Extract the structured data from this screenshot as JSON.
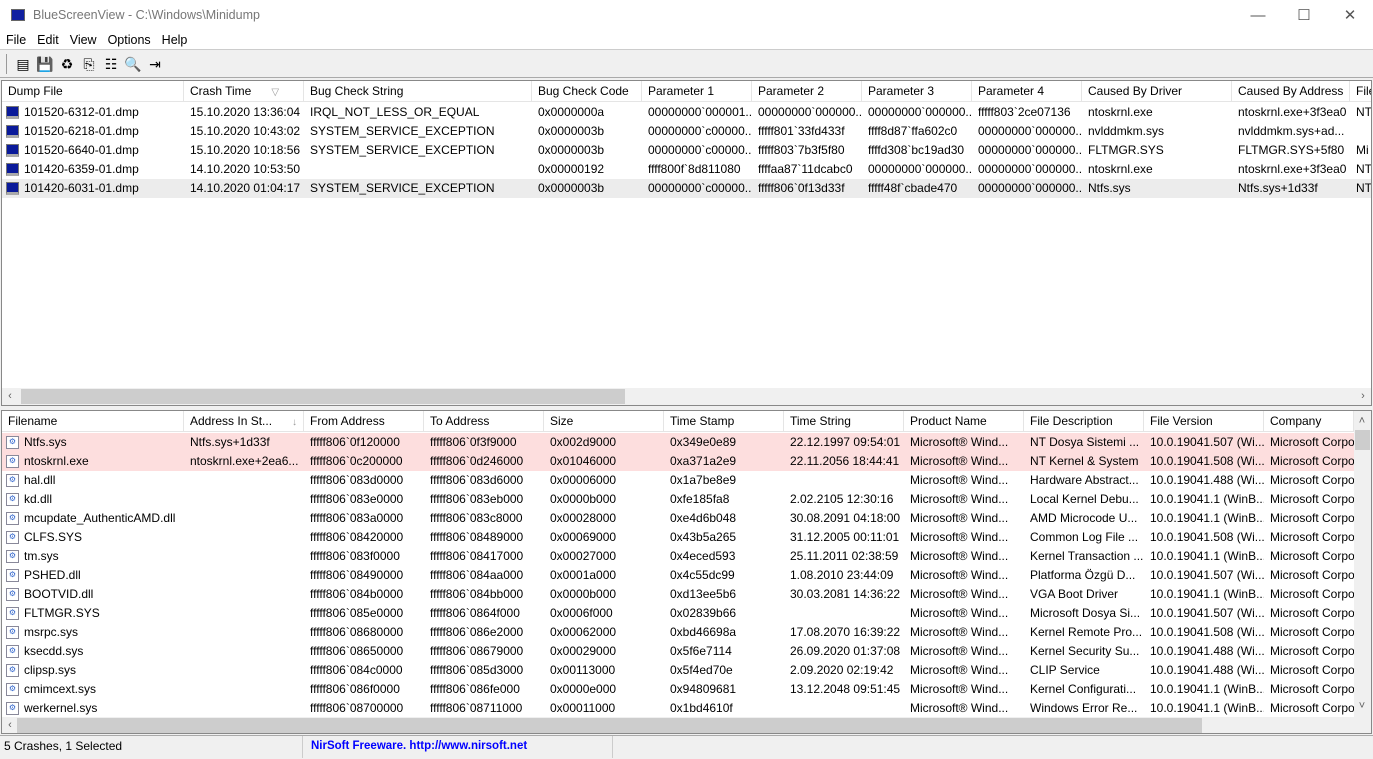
{
  "window": {
    "title": "BlueScreenView  -  C:\\Windows\\Minidump",
    "minimize": "—",
    "maximize": "☐",
    "close": "✕"
  },
  "menu": [
    "File",
    "Edit",
    "View",
    "Options",
    "Help"
  ],
  "toolbar": [
    {
      "icon": "html-report-icon",
      "glyph": "▤"
    },
    {
      "icon": "save-icon",
      "glyph": "💾"
    },
    {
      "icon": "refresh-icon",
      "glyph": "♻"
    },
    {
      "icon": "copy-icon",
      "glyph": "⎘"
    },
    {
      "icon": "properties-icon",
      "glyph": "☷"
    },
    {
      "icon": "find-icon",
      "glyph": "🔍"
    },
    {
      "icon": "exit-icon",
      "glyph": "⇥"
    }
  ],
  "crashes": {
    "columns": [
      "Dump File",
      "Crash Time",
      "Bug Check String",
      "Bug Check Code",
      "Parameter 1",
      "Parameter 2",
      "Parameter 3",
      "Parameter 4",
      "Caused By Driver",
      "Caused By Address",
      "File"
    ],
    "sort_indicator": "▽",
    "rows": [
      [
        "101520-6312-01.dmp",
        "15.10.2020 13:36:04",
        "IRQL_NOT_LESS_OR_EQUAL",
        "0x0000000a",
        "00000000`000001...",
        "00000000`000000...",
        "00000000`000000...",
        "fffff803`2ce07136",
        "ntoskrnl.exe",
        "ntoskrnl.exe+3f3ea0",
        "NT"
      ],
      [
        "101520-6218-01.dmp",
        "15.10.2020 10:43:02",
        "SYSTEM_SERVICE_EXCEPTION",
        "0x0000003b",
        "00000000`c00000...",
        "fffff801`33fd433f",
        "ffff8d87`ffa602c0",
        "00000000`000000...",
        "nvlddmkm.sys",
        "nvlddmkm.sys+ad...",
        ""
      ],
      [
        "101520-6640-01.dmp",
        "15.10.2020 10:18:56",
        "SYSTEM_SERVICE_EXCEPTION",
        "0x0000003b",
        "00000000`c00000...",
        "fffff803`7b3f5f80",
        "ffffd308`bc19ad30",
        "00000000`000000...",
        "FLTMGR.SYS",
        "FLTMGR.SYS+5f80",
        "Mi"
      ],
      [
        "101420-6359-01.dmp",
        "14.10.2020 10:53:50",
        "",
        "0x00000192",
        "ffff800f`8d811080",
        "ffffaa87`11dcabc0",
        "00000000`000000...",
        "00000000`000000...",
        "ntoskrnl.exe",
        "ntoskrnl.exe+3f3ea0",
        "NT"
      ],
      [
        "101420-6031-01.dmp",
        "14.10.2020 01:04:17",
        "SYSTEM_SERVICE_EXCEPTION",
        "0x0000003b",
        "00000000`c00000...",
        "fffff806`0f13d33f",
        "fffff48f`cbade470",
        "00000000`000000...",
        "Ntfs.sys",
        "Ntfs.sys+1d33f",
        "NT"
      ]
    ],
    "selected_row": 4
  },
  "drivers": {
    "columns": [
      "Filename",
      "Address In St...",
      "From Address",
      "To Address",
      "Size",
      "Time Stamp",
      "Time String",
      "Product Name",
      "File Description",
      "File Version",
      "Company"
    ],
    "sort_indicator": "↓",
    "highlight_color": "#fddede",
    "highlighted_rows": [
      0,
      1
    ],
    "rows": [
      [
        "Ntfs.sys",
        "Ntfs.sys+1d33f",
        "fffff806`0f120000",
        "fffff806`0f3f9000",
        "0x002d9000",
        "0x349e0e89",
        "22.12.1997 09:54:01",
        "Microsoft® Wind...",
        "NT Dosya Sistemi ...",
        "10.0.19041.507 (Wi...",
        "Microsoft Corpo"
      ],
      [
        "ntoskrnl.exe",
        "ntoskrnl.exe+2ea6...",
        "fffff806`0c200000",
        "fffff806`0d246000",
        "0x01046000",
        "0xa371a2e9",
        "22.11.2056 18:44:41",
        "Microsoft® Wind...",
        "NT Kernel & System",
        "10.0.19041.508 (Wi...",
        "Microsoft Corpo"
      ],
      [
        "hal.dll",
        "",
        "fffff806`083d0000",
        "fffff806`083d6000",
        "0x00006000",
        "0x1a7be8e9",
        "",
        "Microsoft® Wind...",
        "Hardware Abstract...",
        "10.0.19041.488 (Wi...",
        "Microsoft Corpo"
      ],
      [
        "kd.dll",
        "",
        "fffff806`083e0000",
        "fffff806`083eb000",
        "0x0000b000",
        "0xfe185fa8",
        "2.02.2105 12:30:16",
        "Microsoft® Wind...",
        "Local Kernel Debu...",
        "10.0.19041.1 (WinB...",
        "Microsoft Corpo"
      ],
      [
        "mcupdate_AuthenticAMD.dll",
        "",
        "fffff806`083a0000",
        "fffff806`083c8000",
        "0x00028000",
        "0xe4d6b048",
        "30.08.2091 04:18:00",
        "Microsoft® Wind...",
        "AMD Microcode U...",
        "10.0.19041.1 (WinB...",
        "Microsoft Corpo"
      ],
      [
        "CLFS.SYS",
        "",
        "fffff806`08420000",
        "fffff806`08489000",
        "0x00069000",
        "0x43b5a265",
        "31.12.2005 00:11:01",
        "Microsoft® Wind...",
        "Common Log File ...",
        "10.0.19041.508 (Wi...",
        "Microsoft Corpo"
      ],
      [
        "tm.sys",
        "",
        "fffff806`083f0000",
        "fffff806`08417000",
        "0x00027000",
        "0x4eced593",
        "25.11.2011 02:38:59",
        "Microsoft® Wind...",
        "Kernel Transaction ...",
        "10.0.19041.1 (WinB...",
        "Microsoft Corpo"
      ],
      [
        "PSHED.dll",
        "",
        "fffff806`08490000",
        "fffff806`084aa000",
        "0x0001a000",
        "0x4c55dc99",
        "1.08.2010 23:44:09",
        "Microsoft® Wind...",
        "Platforma Özgü D...",
        "10.0.19041.507 (Wi...",
        "Microsoft Corpo"
      ],
      [
        "BOOTVID.dll",
        "",
        "fffff806`084b0000",
        "fffff806`084bb000",
        "0x0000b000",
        "0xd13ee5b6",
        "30.03.2081 14:36:22",
        "Microsoft® Wind...",
        "VGA Boot Driver",
        "10.0.19041.1 (WinB...",
        "Microsoft Corpo"
      ],
      [
        "FLTMGR.SYS",
        "",
        "fffff806`085e0000",
        "fffff806`0864f000",
        "0x0006f000",
        "0x02839b66",
        "",
        "Microsoft® Wind...",
        "Microsoft Dosya Si...",
        "10.0.19041.507 (Wi...",
        "Microsoft Corpo"
      ],
      [
        "msrpc.sys",
        "",
        "fffff806`08680000",
        "fffff806`086e2000",
        "0x00062000",
        "0xbd46698a",
        "17.08.2070 16:39:22",
        "Microsoft® Wind...",
        "Kernel Remote Pro...",
        "10.0.19041.508 (Wi...",
        "Microsoft Corpo"
      ],
      [
        "ksecdd.sys",
        "",
        "fffff806`08650000",
        "fffff806`08679000",
        "0x00029000",
        "0x5f6e7114",
        "26.09.2020 01:37:08",
        "Microsoft® Wind...",
        "Kernel Security Su...",
        "10.0.19041.488 (Wi...",
        "Microsoft Corpo"
      ],
      [
        "clipsp.sys",
        "",
        "fffff806`084c0000",
        "fffff806`085d3000",
        "0x00113000",
        "0x5f4ed70e",
        "2.09.2020 02:19:42",
        "Microsoft® Wind...",
        "CLIP Service",
        "10.0.19041.488 (Wi...",
        "Microsoft Corpo"
      ],
      [
        "cmimcext.sys",
        "",
        "fffff806`086f0000",
        "fffff806`086fe000",
        "0x0000e000",
        "0x94809681",
        "13.12.2048 09:51:45",
        "Microsoft® Wind...",
        "Kernel Configurati...",
        "10.0.19041.1 (WinB...",
        "Microsoft Corpo"
      ],
      [
        "werkernel.sys",
        "",
        "fffff806`08700000",
        "fffff806`08711000",
        "0x00011000",
        "0x1bd4610f",
        "",
        "Microsoft® Wind...",
        "Windows Error Re...",
        "10.0.19041.1 (WinB...",
        "Microsoft Corpo"
      ]
    ]
  },
  "scroll": {
    "left": "‹",
    "right": "›",
    "up": "˄",
    "down": "˅"
  },
  "status": {
    "crashes": "5 Crashes, 1 Selected",
    "credit": "NirSoft Freeware.  http://www.nirsoft.net"
  }
}
